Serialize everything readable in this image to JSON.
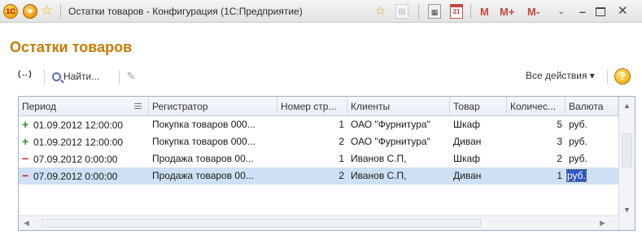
{
  "window": {
    "title": "Остатки товаров - Конфигурация  (1С:Предприятие)",
    "logo_text": "1С",
    "memory_buttons": [
      "M",
      "M+",
      "M-"
    ],
    "calendar_day": "31"
  },
  "page": {
    "title": "Остатки товаров"
  },
  "toolbar": {
    "arrows_label": "(↔)",
    "find_label": "Найти...",
    "all_actions_label": "Все действия ▾",
    "help_label": "?"
  },
  "table": {
    "columns": [
      "Период",
      "Регистратор",
      "Номер стр...",
      "Клиенты",
      "Товар",
      "Количес...",
      "Валюта"
    ],
    "rows": [
      {
        "sign": "+",
        "period": "01.09.2012 12:00:00",
        "registrar": "Покупка товаров 000...",
        "line_no": "1",
        "client": "ОАО \"Фурнитура\"",
        "product": "Шкаф",
        "qty": "5",
        "currency": "руб."
      },
      {
        "sign": "+",
        "period": "01.09.2012 12:00:00",
        "registrar": "Покупка товаров 000...",
        "line_no": "2",
        "client": "ОАО \"Фурнитура\"",
        "product": "Диван",
        "qty": "3",
        "currency": "руб."
      },
      {
        "sign": "−",
        "period": "07.09.2012 0:00:00",
        "registrar": "Продажа товаров 00...",
        "line_no": "1",
        "client": "Иванов С.П,",
        "product": "Шкаф",
        "qty": "2",
        "currency": "руб."
      },
      {
        "sign": "−",
        "period": "07.09.2012 0:00:00",
        "registrar": "Продажа товаров 00...",
        "line_no": "2",
        "client": "Иванов С.П,",
        "product": "Диван",
        "qty": "1",
        "currency": "руб."
      }
    ]
  },
  "colors": {
    "title": "#c97a00",
    "income_sign": "#2e8b2e",
    "expense_sign": "#d42020",
    "selected_row": "#cfe0f4",
    "selected_cell": "#2b56c6"
  }
}
